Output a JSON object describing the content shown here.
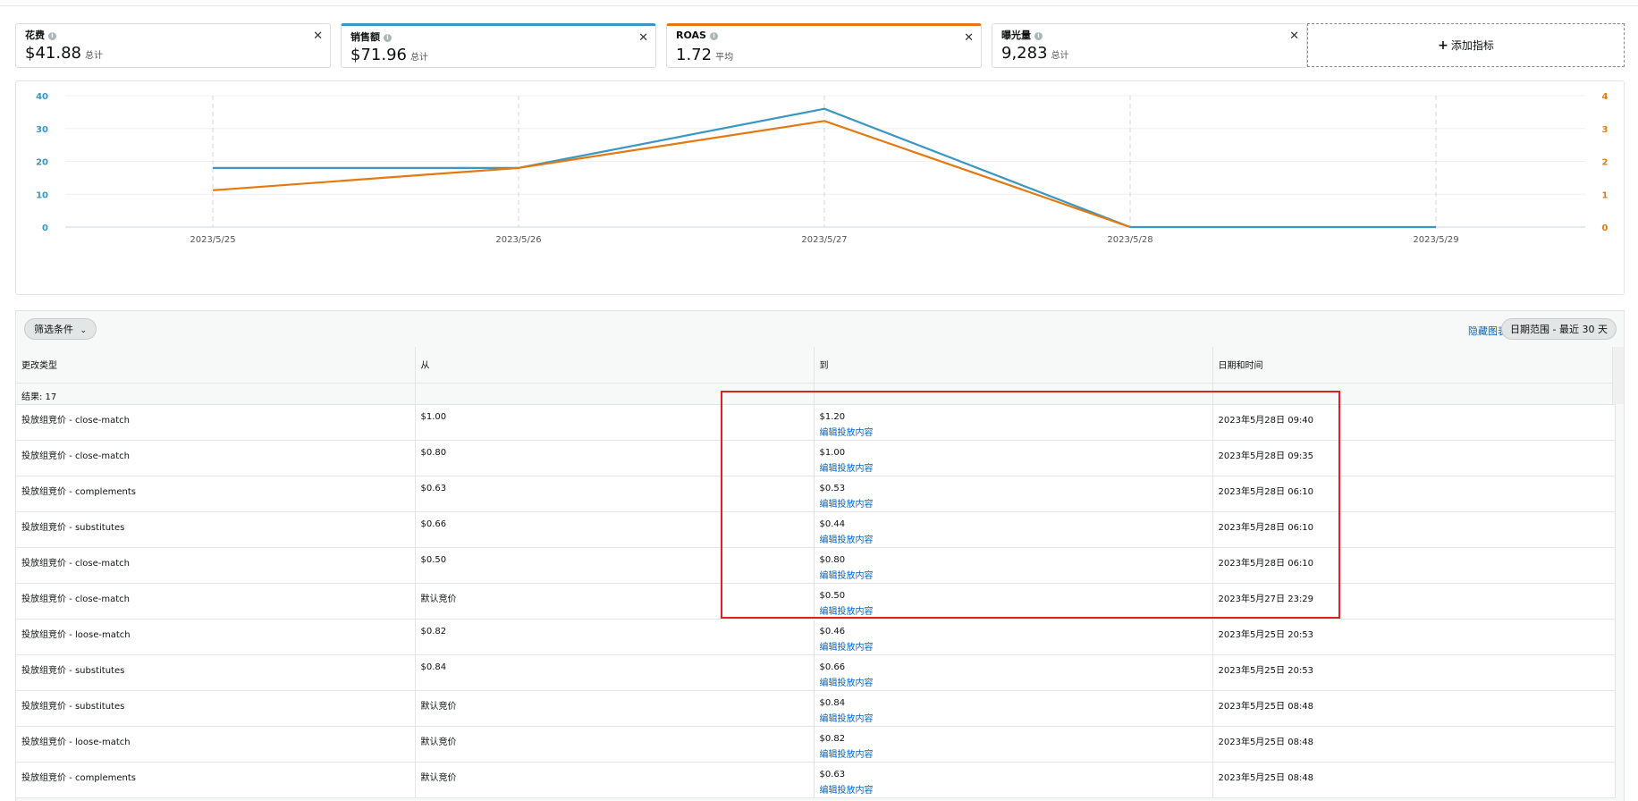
{
  "metrics": [
    {
      "title": "花费",
      "value": "$41.88",
      "sub": "总计",
      "style": "plain"
    },
    {
      "title": "销售额",
      "value": "$71.96",
      "sub": "总计",
      "style": "blue"
    },
    {
      "title": "ROAS",
      "value": "1.72",
      "sub": "平均",
      "style": "orange"
    },
    {
      "title": "曝光量",
      "value": "9,283",
      "sub": "总计",
      "style": "plain"
    }
  ],
  "add_metric_label": "添加指标",
  "colors": {
    "blue": "#3a96c3",
    "orange": "#e47911"
  },
  "icons": {
    "close": "close-icon",
    "info": "info-icon",
    "plus": "plus-icon",
    "chevron": "chevron-down-icon"
  },
  "chart_data": {
    "type": "line",
    "x": [
      "2023/5/25",
      "2023/5/26",
      "2023/5/27",
      "2023/5/28",
      "2023/5/29"
    ],
    "y_left_ticks": [
      0,
      10,
      20,
      30,
      40
    ],
    "y_right_ticks": [
      0,
      1,
      2,
      3,
      4
    ],
    "ylim_left": [
      0,
      40
    ],
    "ylim_right": [
      0,
      4
    ],
    "grid": "vertical-dashed",
    "series": [
      {
        "axis": "left",
        "color": "#3a96c3",
        "values": [
          18,
          18,
          36,
          0,
          0
        ]
      },
      {
        "axis": "right",
        "color": "#e47911",
        "values": [
          1.12,
          1.8,
          3.23,
          0,
          null
        ]
      }
    ]
  },
  "toolbar": {
    "filter_label": "筛选条件",
    "hide_chart": "隐藏图表",
    "date_range": "日期范围 - 最近 30 天"
  },
  "table": {
    "headers": [
      "更改类型",
      "从",
      "到",
      "日期和时间"
    ],
    "result_count": "结果: 17",
    "link_label": "编辑投放内容",
    "rows": [
      {
        "type": "投放组竞价 - close-match",
        "from": "$1.00",
        "to": "$1.20",
        "time": "2023年5月28日 09:40"
      },
      {
        "type": "投放组竞价 - close-match",
        "from": "$0.80",
        "to": "$1.00",
        "time": "2023年5月28日 09:35"
      },
      {
        "type": "投放组竞价 - complements",
        "from": "$0.63",
        "to": "$0.53",
        "time": "2023年5月28日 06:10"
      },
      {
        "type": "投放组竞价 - substitutes",
        "from": "$0.66",
        "to": "$0.44",
        "time": "2023年5月28日 06:10"
      },
      {
        "type": "投放组竞价 - close-match",
        "from": "$0.50",
        "to": "$0.80",
        "time": "2023年5月28日 06:10"
      },
      {
        "type": "投放组竞价 - close-match",
        "from": "默认竞价",
        "to": "$0.50",
        "time": "2023年5月27日 23:29"
      },
      {
        "type": "投放组竞价 - loose-match",
        "from": "$0.82",
        "to": "$0.46",
        "time": "2023年5月25日 20:53"
      },
      {
        "type": "投放组竞价 - substitutes",
        "from": "$0.84",
        "to": "$0.66",
        "time": "2023年5月25日 20:53"
      },
      {
        "type": "投放组竞价 - substitutes",
        "from": "默认竞价",
        "to": "$0.84",
        "time": "2023年5月25日 08:48"
      },
      {
        "type": "投放组竞价 - loose-match",
        "from": "默认竞价",
        "to": "$0.82",
        "time": "2023年5月25日 08:48"
      },
      {
        "type": "投放组竞价 - complements",
        "from": "默认竞价",
        "to": "$0.63",
        "time": "2023年5月25日 08:48"
      }
    ]
  }
}
